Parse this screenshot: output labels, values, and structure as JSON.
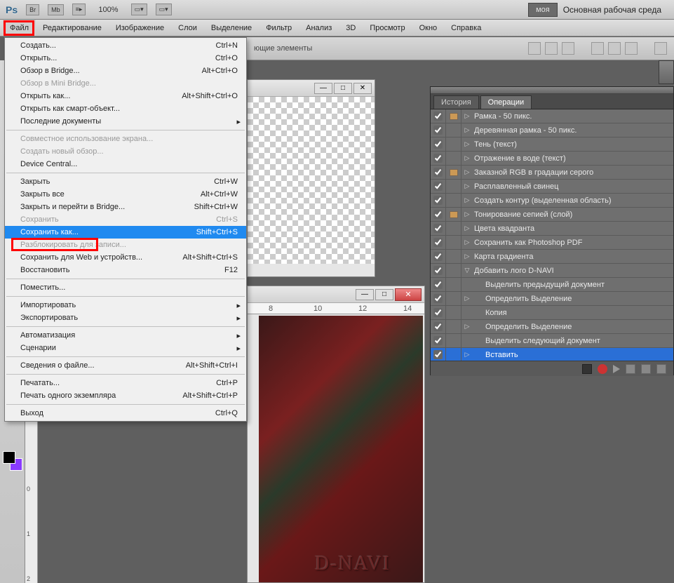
{
  "topbar": {
    "logo": "Ps",
    "br": "Br",
    "mb": "Mb",
    "zoom": "100%",
    "moya": "моя",
    "workspace": "Основная рабочая среда"
  },
  "menubar": [
    "Файл",
    "Редактирование",
    "Изображение",
    "Слои",
    "Выделение",
    "Фильтр",
    "Анализ",
    "3D",
    "Просмотр",
    "Окно",
    "Справка"
  ],
  "dropdown": [
    {
      "l": "Создать...",
      "s": "Ctrl+N"
    },
    {
      "l": "Открыть...",
      "s": "Ctrl+O"
    },
    {
      "l": "Обзор в Bridge...",
      "s": "Alt+Ctrl+O"
    },
    {
      "l": "Обзор в Mini Bridge...",
      "s": "",
      "d": true
    },
    {
      "l": "Открыть как...",
      "s": "Alt+Shift+Ctrl+O"
    },
    {
      "l": "Открыть как смарт-объект...",
      "s": ""
    },
    {
      "l": "Последние документы",
      "s": "",
      "sub": true
    },
    {
      "sep": true
    },
    {
      "l": "Совместное использование экрана...",
      "s": "",
      "d": true
    },
    {
      "l": "Создать новый обзор...",
      "s": "",
      "d": true
    },
    {
      "l": "Device Central...",
      "s": ""
    },
    {
      "sep": true
    },
    {
      "l": "Закрыть",
      "s": "Ctrl+W"
    },
    {
      "l": "Закрыть все",
      "s": "Alt+Ctrl+W"
    },
    {
      "l": "Закрыть и перейти в Bridge...",
      "s": "Shift+Ctrl+W"
    },
    {
      "l": "Сохранить",
      "s": "Ctrl+S",
      "d": true
    },
    {
      "l": "Сохранить как...",
      "s": "Shift+Ctrl+S",
      "sel": true
    },
    {
      "l": "Разблокировать для записи...",
      "s": "",
      "d": true
    },
    {
      "l": "Сохранить для Web и устройств...",
      "s": "Alt+Shift+Ctrl+S"
    },
    {
      "l": "Восстановить",
      "s": "F12"
    },
    {
      "sep": true
    },
    {
      "l": "Поместить...",
      "s": ""
    },
    {
      "sep": true
    },
    {
      "l": "Импортировать",
      "s": "",
      "sub": true
    },
    {
      "l": "Экспортировать",
      "s": "",
      "sub": true
    },
    {
      "sep": true
    },
    {
      "l": "Автоматизация",
      "s": "",
      "sub": true
    },
    {
      "l": "Сценарии",
      "s": "",
      "sub": true
    },
    {
      "sep": true
    },
    {
      "l": "Сведения о файле...",
      "s": "Alt+Shift+Ctrl+I"
    },
    {
      "sep": true
    },
    {
      "l": "Печатать...",
      "s": "Ctrl+P"
    },
    {
      "l": "Печать одного экземпляра",
      "s": "Alt+Shift+Ctrl+P"
    },
    {
      "sep": true
    },
    {
      "l": "Выход",
      "s": "Ctrl+Q"
    }
  ],
  "toolbar2_label": "ющие элементы",
  "panel": {
    "tab1": "История",
    "tab2": "Операции",
    "rows": [
      {
        "c": true,
        "m": true,
        "e": "▷",
        "l": "Рамка - 50 пикс."
      },
      {
        "c": true,
        "m": false,
        "e": "▷",
        "l": "Деревянная рамка - 50 пикс."
      },
      {
        "c": true,
        "m": false,
        "e": "▷",
        "l": "Тень (текст)"
      },
      {
        "c": true,
        "m": false,
        "e": "▷",
        "l": "Отражение в воде (текст)"
      },
      {
        "c": true,
        "m": true,
        "e": "▷",
        "l": "Заказной RGB в градации серого"
      },
      {
        "c": true,
        "m": false,
        "e": "▷",
        "l": "Расплавленный свинец"
      },
      {
        "c": true,
        "m": false,
        "e": "▷",
        "l": "Создать контур (выделенная область)"
      },
      {
        "c": true,
        "m": true,
        "e": "▷",
        "l": "Тонирование сепией (слой)"
      },
      {
        "c": true,
        "m": false,
        "e": "▷",
        "l": "Цвета квадранта"
      },
      {
        "c": true,
        "m": false,
        "e": "▷",
        "l": "Сохранить как Photoshop PDF"
      },
      {
        "c": true,
        "m": false,
        "e": "▷",
        "l": "Карта градиента"
      },
      {
        "c": true,
        "m": false,
        "e": "▽",
        "l": "Добавить лого D-NAVI"
      },
      {
        "c": true,
        "m": false,
        "e": "",
        "l": "Выделить  предыдущий документ",
        "sub": true
      },
      {
        "c": true,
        "m": false,
        "e": "▷",
        "l": "Определить Выделение",
        "sub": true
      },
      {
        "c": true,
        "m": false,
        "e": "",
        "l": "Копия",
        "sub": true
      },
      {
        "c": true,
        "m": false,
        "e": "▷",
        "l": "Определить Выделение",
        "sub": true
      },
      {
        "c": true,
        "m": false,
        "e": "",
        "l": "Выделить  следующий документ",
        "sub": true
      },
      {
        "c": true,
        "m": false,
        "e": "▷",
        "l": "Вставить",
        "sub": true,
        "sel": true
      }
    ]
  },
  "ruler2": [
    "8",
    "10",
    "12",
    "14"
  ],
  "ruler_v": [
    "0",
    "1",
    "2"
  ],
  "dnavi": "D-NAVI"
}
